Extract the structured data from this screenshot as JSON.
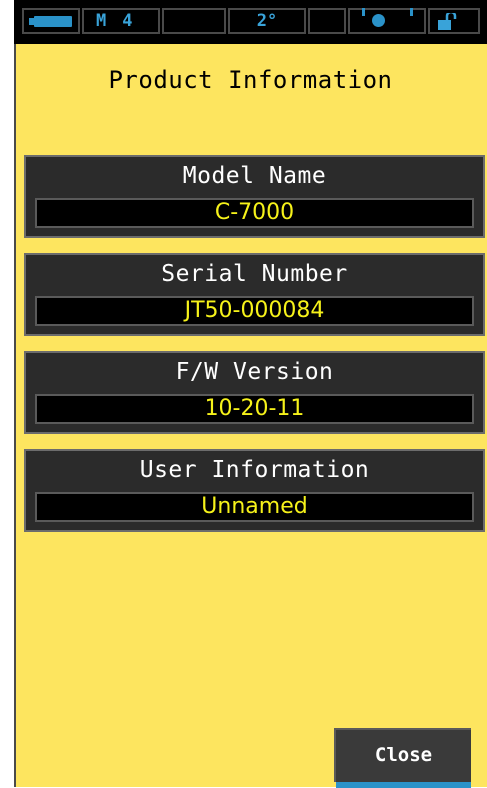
{
  "status_bar": {
    "mode_letter": "M",
    "mode_number": "4",
    "angle": "2°",
    "icons": [
      "battery-icon",
      "meter-icon",
      "lock-icon"
    ]
  },
  "title": "Product Information",
  "fields": [
    {
      "label": "Model Name",
      "value": "C-7000"
    },
    {
      "label": "Serial Number",
      "value": "JT50-000084"
    },
    {
      "label": "F/W Version",
      "value": "10-20-11"
    },
    {
      "label": "User Information",
      "value": "Unnamed"
    }
  ],
  "close_label": "Close",
  "colors": {
    "background": "#fde55f",
    "panel": "#2b2b2b",
    "value_text": "#f6f21a",
    "accent": "#2a92c9"
  }
}
